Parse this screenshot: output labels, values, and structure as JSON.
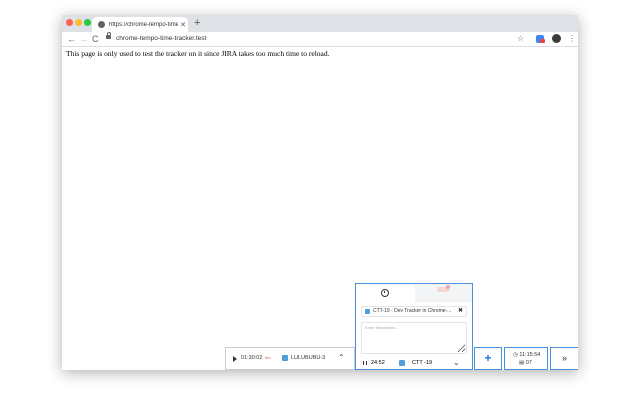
{
  "browser": {
    "tab_title": "https://chrome-tempo-time-t",
    "tab_close": "✕",
    "new_tab": "+",
    "url": "chrome-tempo-time-tracker.test"
  },
  "page": {
    "text": "This page is only used to test the tracker on it since JIRA takes too much time to reload."
  },
  "tracker_bar": {
    "time": "01:30:02",
    "time_suffix": "0m",
    "issue_key": "LULUBUBU-3"
  },
  "popup": {
    "issue_chip": "CTT-19 - Dev Tracker in Chrome-...",
    "description_placeholder": "Enter description...",
    "active_time": "24:52",
    "active_key": "CTT -19"
  },
  "summary": {
    "total_time": "11:15:54",
    "count": "07"
  },
  "controls": {
    "add_label": "+",
    "expand_label": "»"
  },
  "colors": {
    "accent": "#4a90d9",
    "jira_blue": "#4b9fdb",
    "add_blue": "#1a73e8"
  }
}
